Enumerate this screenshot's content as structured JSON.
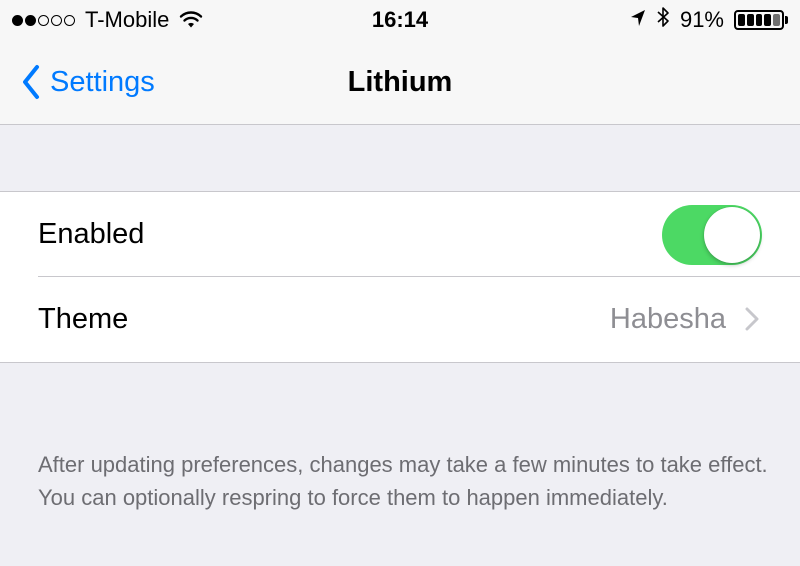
{
  "status_bar": {
    "carrier": "T-Mobile",
    "signal_bars": 2,
    "time": "16:14",
    "battery": "91%",
    "battery_level": 0.91,
    "icons": [
      "wifi-icon",
      "location-arrow-icon",
      "bluetooth-icon",
      "battery-icon"
    ]
  },
  "nav": {
    "back_label": "Settings",
    "title": "Lithium"
  },
  "settings": {
    "enabled_label": "Enabled",
    "enabled_value": true,
    "theme_label": "Theme",
    "theme_value": "Habesha"
  },
  "footer": {
    "text": "After updating preferences, changes may take a few minutes to take effect. You can optionally respring to force them to happen immediately."
  },
  "colors": {
    "accent": "#007aff",
    "toggle_on": "#4cd964",
    "background": "#efeff4",
    "footer_text": "#6d6d72",
    "detail_text": "#8e8e93"
  }
}
